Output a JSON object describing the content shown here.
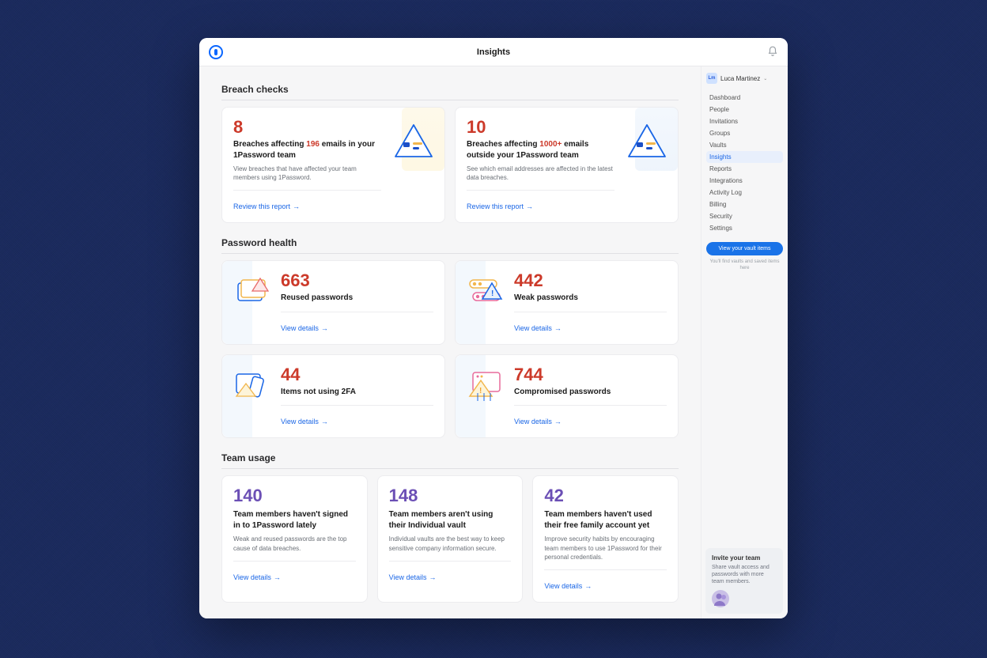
{
  "header": {
    "title": "Insights"
  },
  "user": {
    "initials": "Lm",
    "name": "Luca Martinez"
  },
  "sidebar": {
    "items": [
      "Dashboard",
      "People",
      "Invitations",
      "Groups",
      "Vaults",
      "Insights",
      "Reports",
      "Integrations",
      "Activity Log",
      "Billing",
      "Security",
      "Settings"
    ],
    "active_index": 5,
    "vault_button": "View your vault items",
    "vault_sub": "You'll find vaults and saved items here"
  },
  "invite": {
    "title": "Invite your team",
    "sub": "Share vault access and passwords with more team members."
  },
  "sections": {
    "breach": {
      "heading": "Breach checks",
      "cards": [
        {
          "count": "8",
          "title_pre": "Breaches affecting ",
          "title_hl": "196",
          "title_post": " emails in your 1Password team",
          "sub": "View breaches that have affected your team members using 1Password.",
          "link": "Review this report"
        },
        {
          "count": "10",
          "title_pre": "Breaches affecting ",
          "title_hl": "1000+",
          "title_post": " emails outside your 1Password team",
          "sub": "See which email addresses are affected in the latest data breaches.",
          "link": "Review this report"
        }
      ]
    },
    "health": {
      "heading": "Password health",
      "cards": [
        {
          "count": "663",
          "label": "Reused passwords",
          "link": "View details"
        },
        {
          "count": "442",
          "label": "Weak passwords",
          "link": "View details"
        },
        {
          "count": "44",
          "label": "Items not using 2FA",
          "link": "View details"
        },
        {
          "count": "744",
          "label": "Compromised passwords",
          "link": "View details"
        }
      ]
    },
    "team": {
      "heading": "Team usage",
      "cards": [
        {
          "count": "140",
          "title": "Team members haven't signed in to 1Password lately",
          "sub": "Weak and reused passwords are the top cause of data breaches.",
          "link": "View details"
        },
        {
          "count": "148",
          "title": "Team members aren't using their Individual vault",
          "sub": "Individual vaults are the best way to keep sensitive company information secure.",
          "link": "View details"
        },
        {
          "count": "42",
          "title": "Team members haven't used their free family account yet",
          "sub": "Improve security habits by encouraging team members to use 1Password for their personal credentials.",
          "link": "View details"
        }
      ]
    }
  }
}
